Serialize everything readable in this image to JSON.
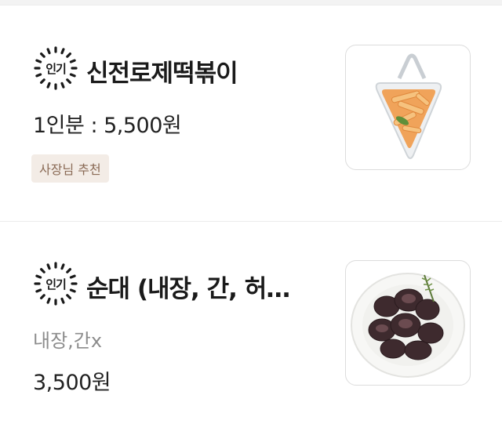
{
  "menu": {
    "items": [
      {
        "badge": "인기",
        "name": "신전로제떡볶이",
        "price": "1인분 : 5,500원",
        "tag": "사장님 추천",
        "image_icon": "rose-tteokbokki-photo"
      },
      {
        "badge": "인기",
        "name": "순대 (내장, 간, 허…",
        "description": "내장,간x",
        "price": "3,500원",
        "image_icon": "sundae-photo"
      }
    ]
  }
}
